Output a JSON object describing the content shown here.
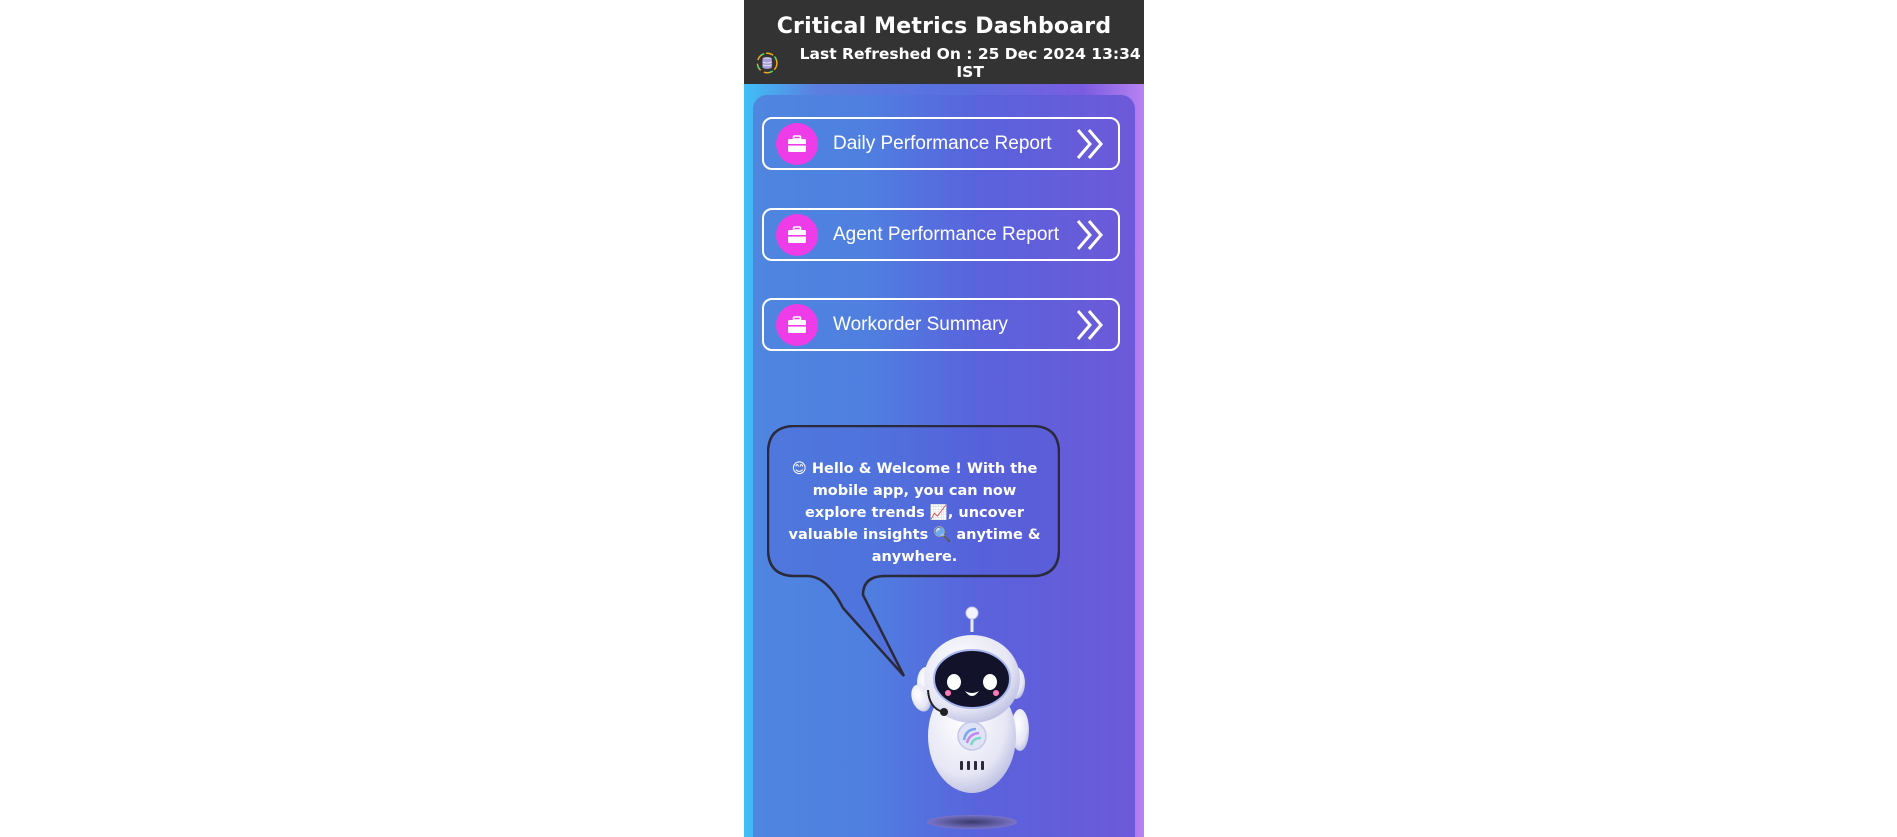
{
  "header": {
    "title": "Critical Metrics Dashboard",
    "refresh_text": "Last Refreshed On : 25 Dec 2024 13:34 IST",
    "refresh_icon": "database-icon"
  },
  "reports": [
    {
      "label": "Daily Performance Report",
      "icon": "briefcase-icon",
      "action_icon": "double-chevron-right-icon"
    },
    {
      "label": "Agent Performance Report",
      "icon": "briefcase-icon",
      "action_icon": "double-chevron-right-icon"
    },
    {
      "label": "Workorder Summary",
      "icon": "briefcase-icon",
      "action_icon": "double-chevron-right-icon"
    }
  ],
  "welcome": {
    "message": "😊 Hello & Welcome ! With the mobile app, you can now explore trends 📈, uncover valuable insights 🔍 anytime & anywhere."
  },
  "colors": {
    "header_bg": "#333333",
    "icon_circle": "#ee3ce8",
    "panel_start": "#4f86e0",
    "panel_end": "#6d59d9"
  }
}
